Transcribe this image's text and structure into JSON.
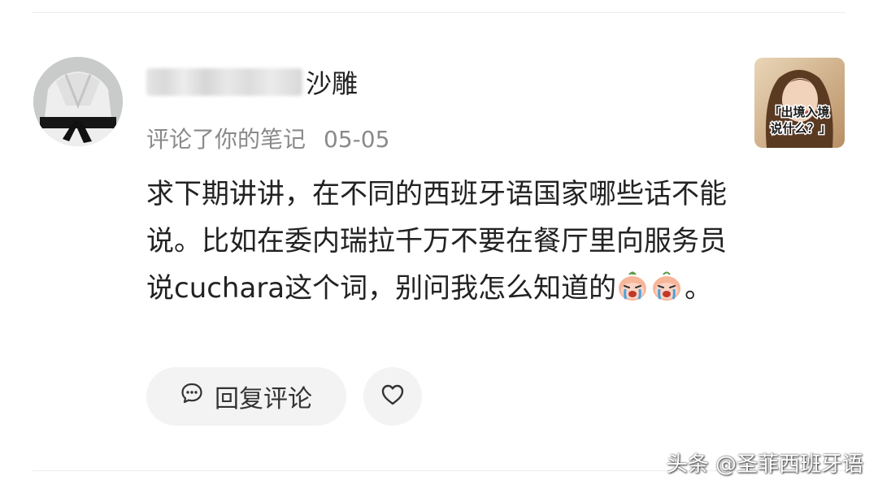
{
  "comment_card": {
    "username_suffix": "沙雕",
    "action_text": "评论了你的笔记",
    "date": "05-05",
    "thumbnail_caption_line1": "「出境入境",
    "thumbnail_caption_line2": "说什么？」",
    "comment_text_before_emoji": "求下期讲讲，在不同的西班牙语国家哪些话不能说。比如在委内瑞拉千万不要在餐厅里向服务员说cuchara这个词，别问我怎么知道的",
    "comment_text_after_emoji": "。",
    "emoji_icons": [
      "crying-face-icon",
      "crying-face-icon"
    ]
  },
  "actions": {
    "reply_label": "回复评论",
    "reply_icon": "chat-bubble-icon",
    "like_icon": "heart-outline-icon"
  },
  "watermark": {
    "text": "头条 @圣菲西班牙语"
  }
}
